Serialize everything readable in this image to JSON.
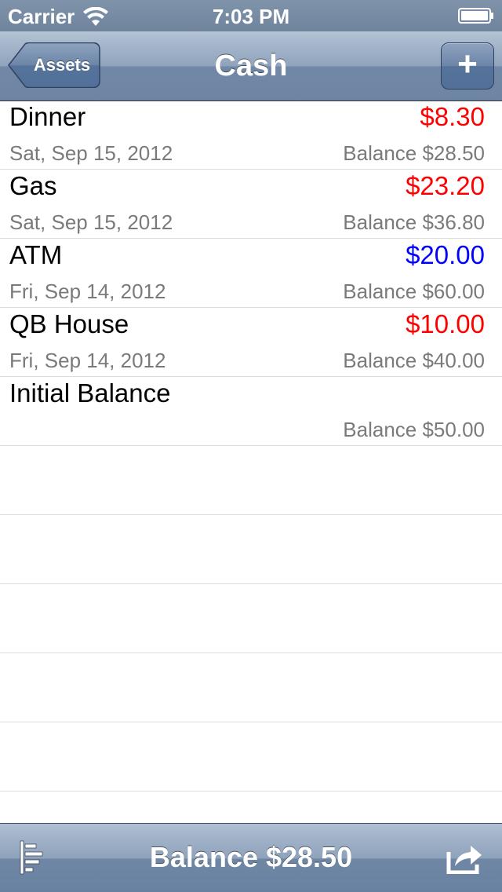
{
  "status_bar": {
    "carrier": "Carrier",
    "time": "7:03 PM",
    "icons": [
      "wifi-icon",
      "battery-icon"
    ]
  },
  "nav_bar": {
    "back_label": "Assets",
    "title": "Cash",
    "add_label": "+"
  },
  "transactions": [
    {
      "title": "Dinner",
      "amount": "$8.30",
      "amount_color": "#ff0000",
      "date": "Sat, Sep 15, 2012",
      "balance": "Balance $28.50"
    },
    {
      "title": "Gas",
      "amount": "$23.20",
      "amount_color": "#ff0000",
      "date": "Sat, Sep 15, 2012",
      "balance": "Balance $36.80"
    },
    {
      "title": "ATM",
      "amount": "$20.00",
      "amount_color": "#0000ff",
      "date": "Fri, Sep 14, 2012",
      "balance": "Balance $60.00"
    },
    {
      "title": "QB House",
      "amount": "$10.00",
      "amount_color": "#ff0000",
      "date": "Fri, Sep 14, 2012",
      "balance": "Balance $40.00"
    },
    {
      "title": "Initial Balance",
      "amount": "",
      "amount_color": "#000000",
      "date": "",
      "balance": "Balance $50.00"
    }
  ],
  "toolbar": {
    "balance_label": "Balance $28.50",
    "left_icon": "list-icon",
    "right_icon": "share-icon"
  },
  "colors": {
    "expense": "#ff0000",
    "income": "#0000ff",
    "nav_bar": "#6d84a2"
  }
}
